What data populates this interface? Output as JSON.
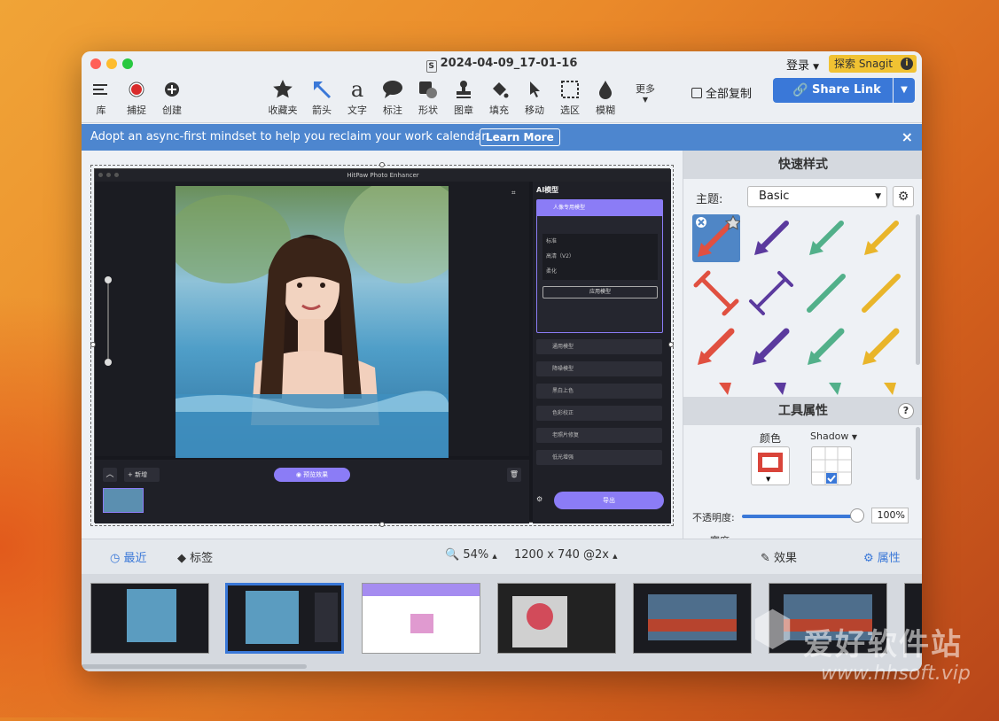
{
  "window": {
    "title": "2024-04-09_17-01-16",
    "title_icon": "S"
  },
  "header": {
    "login": "登录",
    "explore": "探索 Snagit",
    "info": "i"
  },
  "toolbar": {
    "left": [
      {
        "label": "库"
      },
      {
        "label": "捕捉"
      },
      {
        "label": "创建"
      }
    ],
    "tools": [
      {
        "label": "收藏夹"
      },
      {
        "label": "箭头"
      },
      {
        "label": "文字"
      },
      {
        "label": "标注"
      },
      {
        "label": "形状"
      },
      {
        "label": "图章"
      },
      {
        "label": "填充"
      },
      {
        "label": "移动"
      },
      {
        "label": "选区"
      },
      {
        "label": "模糊"
      }
    ],
    "more": "更多",
    "copy_all": "全部复制",
    "share_link": "Share Link"
  },
  "banner": {
    "text": "Adopt an async-first mindset to help you reclaim your work calendar.",
    "button": "Learn More",
    "close": "×"
  },
  "canvas": {
    "app_title": "HitPaw Photo Enhancer",
    "ai_model": "AI模型",
    "models": [
      "人像专用模型",
      "通用模型",
      "降噪模型",
      "黑白上色",
      "色彩校正",
      "老照片修复",
      "低光增强"
    ],
    "sub_options": [
      "标准",
      "高清（V2）",
      "柔化"
    ],
    "apply_button": "应用模型",
    "add": "新增",
    "preview": "预览效果",
    "export_all": "导出"
  },
  "quickstyles": {
    "title": "快速样式",
    "theme_label": "主题:",
    "theme_value": "Basic"
  },
  "properties": {
    "title": "工具属性",
    "color_label": "颜色",
    "shadow_label": "Shadow",
    "opacity_label": "不透明度:",
    "opacity_value": "100%",
    "width_label": "宽度"
  },
  "bottom": {
    "recent": "最近",
    "tags": "标签",
    "zoom": "54%",
    "size": "1200 x 740 @2x",
    "effects": "效果",
    "properties": "属性"
  },
  "watermark": {
    "logo": "爱好软件站",
    "url": "www.hhsoft.vip"
  },
  "colors": {
    "accent": "#3a78d8",
    "purple": "#8b7cf6",
    "arrow_red": "#e05040",
    "arrow_purple": "#5b3a9e",
    "arrow_green": "#52b08a",
    "arrow_yellow": "#e9b52a"
  }
}
